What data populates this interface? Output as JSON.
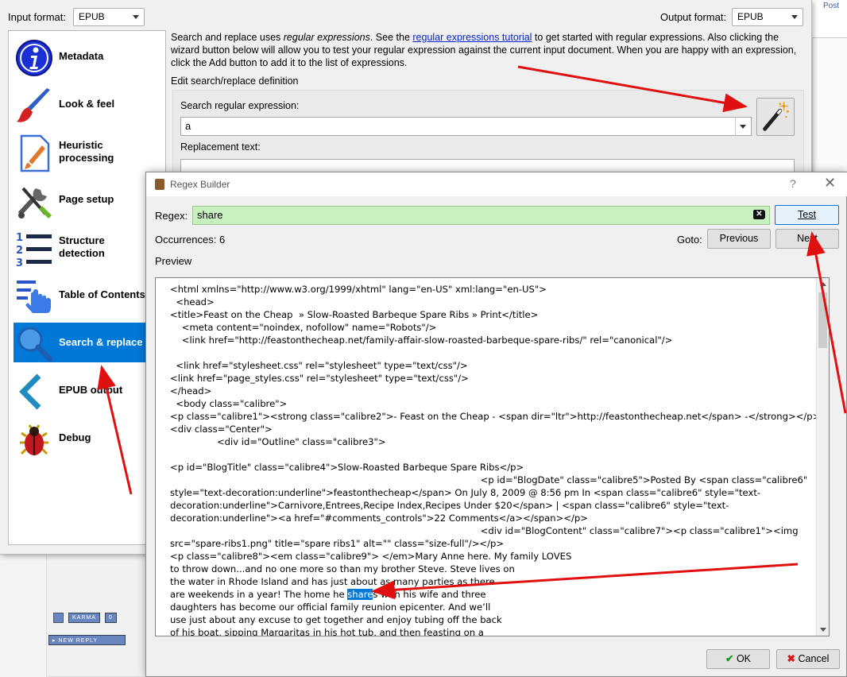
{
  "background": {
    "top_link": "Post",
    "karma_label": "KARMA",
    "karma_count": "0",
    "new_reply": "NEW REPLY"
  },
  "main": {
    "input_format_label": "Input format:",
    "input_format_value": "EPUB",
    "output_format_label": "Output format:",
    "output_format_value": "EPUB",
    "sidebar": [
      {
        "label": "Metadata",
        "icon": "info-icon"
      },
      {
        "label": "Look & feel",
        "icon": "brush-icon"
      },
      {
        "label": "Heuristic processing",
        "icon": "document-icon"
      },
      {
        "label": "Page setup",
        "icon": "tools-icon"
      },
      {
        "label": "Structure detection",
        "icon": "list-numbers-icon"
      },
      {
        "label": "Table of Contents",
        "icon": "toc-icon"
      },
      {
        "label": "Search & replace",
        "icon": "magnifier-icon"
      },
      {
        "label": "EPUB output",
        "icon": "chevron-left-icon"
      },
      {
        "label": "Debug",
        "icon": "bug-icon"
      }
    ],
    "help_pre": "Search and replace uses ",
    "help_em": "regular expressions",
    "help_mid": ". See the ",
    "help_link": "regular expressions tutorial",
    "help_post": " to get started with regular expressions. Also clicking the wizard button below will allow you to test your regular expression against the current input document. When you are happy with an expression, click the Add button to add it to the list of expressions.",
    "edit_title": "Edit search/replace definition",
    "search_label": "Search regular expression:",
    "search_value": "a",
    "replace_label": "Replacement text:",
    "replace_value": ""
  },
  "dialog": {
    "title": "Regex Builder",
    "help_glyph": "?",
    "close_glyph": "✕",
    "regex_label": "Regex:",
    "regex_value": "share",
    "test_button": "Test",
    "occurrences_label": "Occurrences:",
    "occurrences_value": "6",
    "goto_label": "Goto:",
    "previous_button": "Previous",
    "next_button": "Next",
    "preview_label": "Preview",
    "preview_before": "<html xmlns=\"http://www.w3.org/1999/xhtml\" lang=\"en-US\" xml:lang=\"en-US\">\n  <head>\n<title>Feast on the Cheap  » Slow-Roasted Barbeque Spare Ribs » Print</title>\n    <meta content=\"noindex, nofollow\" name=\"Robots\"/>\n    <link href=\"http://feastonthecheap.net/family-affair-slow-roasted-barbeque-spare-ribs/\" rel=\"canonical\"/>\n\n  <link href=\"stylesheet.css\" rel=\"stylesheet\" type=\"text/css\"/>\n<link href=\"page_styles.css\" rel=\"stylesheet\" type=\"text/css\"/>\n</head>\n  <body class=\"calibre\">\n<p class=\"calibre1\"><strong class=\"calibre2\">- Feast on the Cheap - <span dir=\"ltr\">http://feastonthecheap.net</span> -</strong></p>\n<div class=\"Center\">\n                <div id=\"Outline\" class=\"calibre3\">\n\n<p id=\"BlogTitle\" class=\"calibre4\">Slow-Roasted Barbeque Spare Ribs</p>\n                                                                                                          <p id=\"BlogDate\" class=\"calibre5\">Posted By <span class=\"calibre6\"\nstyle=\"text-decoration:underline\">feastonthecheap</span> On July 8, 2009 @ 8:56 pm In <span class=\"calibre6\" style=\"text-\ndecoration:underline\">Carnivore,Entrees,Recipe Index,Recipes Under $20</span> | <span class=\"calibre6\" style=\"text-\ndecoration:underline\"><a href=\"#comments_controls\">22 Comments</a></span></p>\n                                                                                                          <div id=\"BlogContent\" class=\"calibre7\"><p class=\"calibre1\"><img\nsrc=\"spare-ribs1.png\" title=\"spare ribs1\" alt=\"\" class=\"size-full\"/></p>\n<p class=\"calibre8\"><em class=\"calibre9\"> </em>Mary Anne here. My family LOVES\nto throw down...and no one more so than my brother Steve. Steve lives on\nthe water in Rhode Island and has just about as many parties as there\nare weekends in a year! The home he ",
    "preview_match": "share",
    "preview_after": "s with his wife and three\ndaughters has become our official family reunion epicenter. And we’ll\nuse just about any excuse to get together and enjoy tubing off the back\nof his boat, sipping Margaritas in his hot tub, and then feasting on a",
    "ok_button": "OK",
    "cancel_button": "Cancel"
  },
  "colors": {
    "selection": "#0078d7",
    "regex_valid_bg": "#c8f0c0",
    "annotation_arrow": "#e01010"
  }
}
